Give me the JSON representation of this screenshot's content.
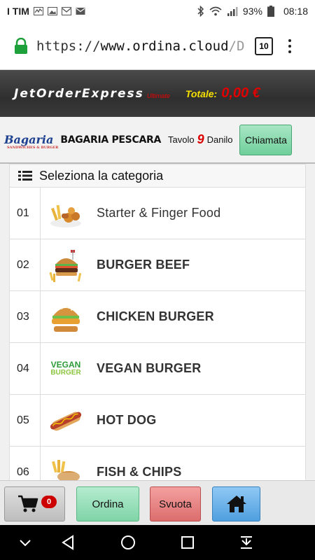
{
  "status_bar": {
    "carrier": "I TIM",
    "battery": "93%",
    "time": "08:18"
  },
  "browser": {
    "url_scheme": "https://",
    "url_host": "www.ordina.cloud",
    "url_rest": "/D",
    "tab_count": "10"
  },
  "brand": {
    "logo": "JetOrderExpress",
    "logo_sub": "Ultimate",
    "total_label": "Totale:",
    "total_value": "0,00 €"
  },
  "restaurant": {
    "logo": "Bagaria",
    "logo_tagline": "SANDWICHES & BURGER",
    "name": "BAGARIA PESCARA",
    "table_label": "Tavolo",
    "table_number": "9",
    "waiter": "Danilo",
    "call_button": "Chiamata"
  },
  "categories": {
    "header": "Seleziona la categoria",
    "items": [
      {
        "num": "01",
        "name": "Starter & Finger Food",
        "icon": "finger-food"
      },
      {
        "num": "02",
        "name": "BURGER BEEF",
        "icon": "burger"
      },
      {
        "num": "03",
        "name": "CHICKEN BURGER",
        "icon": "chicken-burger"
      },
      {
        "num": "04",
        "name": "VEGAN BURGER",
        "icon": "vegan-logo"
      },
      {
        "num": "05",
        "name": "HOT DOG",
        "icon": "hot-dog"
      },
      {
        "num": "06",
        "name": "FISH & CHIPS",
        "icon": "fish-chips"
      }
    ],
    "vegan_icon_text_1": "VEGAN",
    "vegan_icon_text_2": "BURGER"
  },
  "footer": {
    "cart_count": "0",
    "order_label": "Ordina",
    "clear_label": "Svuota"
  },
  "colors": {
    "total_label": "#f5e000",
    "total_value": "#e00000",
    "call_button": "#6fcf9b",
    "order_button": "#7fd4a7",
    "clear_button": "#dc6d6d",
    "home_button": "#4f9fdf"
  }
}
